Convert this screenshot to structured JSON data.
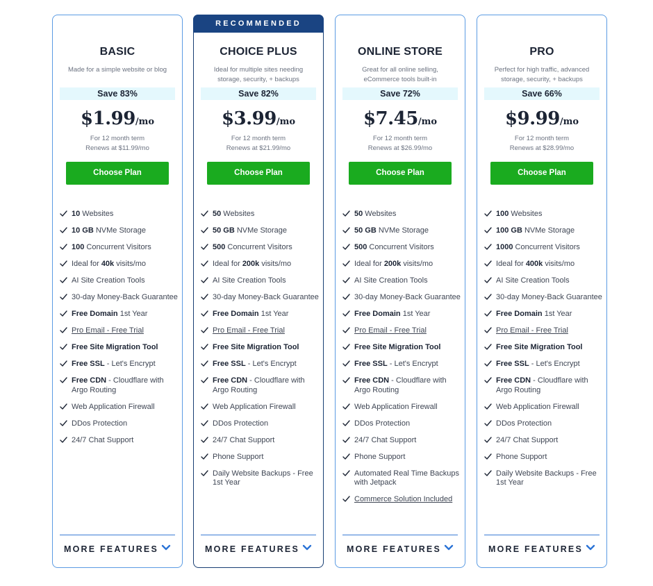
{
  "colors": {
    "card_border": "#5b9be3",
    "recommended_border": "#173d72",
    "recommended_banner": "#1a4482",
    "save_bg": "#e4f8fd",
    "button": "#1aab1f",
    "divider": "#3a7bd5",
    "chevron": "#2b73d6"
  },
  "recommended_label": "RECOMMENDED",
  "plans": [
    {
      "name": "BASIC",
      "description": "Made for a simple website or blog",
      "save": "Save 83%",
      "price": "$1.99",
      "per": "/mo",
      "term": "For 12 month term",
      "renews": "Renews at $11.99/mo",
      "button": "Choose Plan",
      "more": "MORE FEATURES",
      "features": [
        {
          "bold": "10",
          "text": " Websites"
        },
        {
          "bold": "10 GB",
          "text": " NVMe Storage"
        },
        {
          "bold": "100",
          "text": " Concurrent Visitors"
        },
        {
          "pre": "Ideal for ",
          "bold": "40k",
          "text": " visits/mo"
        },
        {
          "text": "AI Site Creation Tools"
        },
        {
          "text": "30-day Money-Back Guarantee"
        },
        {
          "bold": "Free Domain",
          "text": " 1st Year"
        },
        {
          "link": "Pro Email - Free Trial"
        },
        {
          "bold": "Free Site Migration Tool"
        },
        {
          "bold": "Free SSL",
          "text": " - Let's Encrypt"
        },
        {
          "bold": "Free CDN",
          "text": " - Cloudflare with Argo Routing"
        },
        {
          "text": "Web Application Firewall"
        },
        {
          "text": "DDos Protection"
        },
        {
          "text": "24/7 Chat Support"
        }
      ]
    },
    {
      "name": "CHOICE PLUS",
      "recommended": true,
      "description": "Ideal for multiple sites needing storage, security, + backups",
      "save": "Save 82%",
      "price": "$3.99",
      "per": "/mo",
      "term": "For 12 month term",
      "renews": "Renews at $21.99/mo",
      "button": "Choose Plan",
      "more": "MORE FEATURES",
      "features": [
        {
          "bold": "50",
          "text": " Websites"
        },
        {
          "bold": "50 GB",
          "text": " NVMe Storage"
        },
        {
          "bold": "500",
          "text": " Concurrent Visitors"
        },
        {
          "pre": "Ideal for ",
          "bold": "200k",
          "text": " visits/mo"
        },
        {
          "text": "AI Site Creation Tools"
        },
        {
          "text": "30-day Money-Back Guarantee"
        },
        {
          "bold": "Free Domain",
          "text": " 1st Year"
        },
        {
          "link": "Pro Email - Free Trial"
        },
        {
          "bold": "Free Site Migration Tool"
        },
        {
          "bold": "Free SSL",
          "text": " - Let's Encrypt"
        },
        {
          "bold": "Free CDN",
          "text": " - Cloudflare with Argo Routing"
        },
        {
          "text": "Web Application Firewall"
        },
        {
          "text": "DDos Protection"
        },
        {
          "text": "24/7 Chat Support"
        },
        {
          "text": "Phone Support"
        },
        {
          "text": "Daily Website Backups - Free 1st Year"
        }
      ]
    },
    {
      "name": "ONLINE STORE",
      "description": "Great for all online selling, eCommerce tools built-in",
      "save": "Save 72%",
      "price": "$7.45",
      "per": "/mo",
      "term": "For 12 month term",
      "renews": "Renews at $26.99/mo",
      "button": "Choose Plan",
      "more": "MORE FEATURES",
      "features": [
        {
          "bold": "50",
          "text": " Websites"
        },
        {
          "bold": "50 GB",
          "text": " NVMe Storage"
        },
        {
          "bold": "500",
          "text": " Concurrent Visitors"
        },
        {
          "pre": "Ideal for ",
          "bold": "200k",
          "text": " visits/mo"
        },
        {
          "text": "AI Site Creation Tools"
        },
        {
          "text": "30-day Money-Back Guarantee"
        },
        {
          "bold": "Free Domain",
          "text": " 1st Year"
        },
        {
          "link": "Pro Email - Free Trial"
        },
        {
          "bold": "Free Site Migration Tool"
        },
        {
          "bold": "Free SSL",
          "text": " - Let's Encrypt"
        },
        {
          "bold": "Free CDN",
          "text": " - Cloudflare with Argo Routing"
        },
        {
          "text": "Web Application Firewall"
        },
        {
          "text": "DDos Protection"
        },
        {
          "text": "24/7 Chat Support"
        },
        {
          "text": "Phone Support"
        },
        {
          "text": "Automated Real Time Backups with Jetpack"
        },
        {
          "link": "Commerce Solution Included"
        }
      ]
    },
    {
      "name": "PRO",
      "description": "Perfect for high traffic, advanced storage, security, + backups",
      "save": "Save 66%",
      "price": "$9.99",
      "per": "/mo",
      "term": "For 12 month term",
      "renews": "Renews at $28.99/mo",
      "button": "Choose Plan",
      "more": "MORE FEATURES",
      "features": [
        {
          "bold": "100",
          "text": " Websites"
        },
        {
          "bold": "100 GB",
          "text": " NVMe Storage"
        },
        {
          "bold": "1000",
          "text": " Concurrent Visitors"
        },
        {
          "pre": "Ideal for ",
          "bold": "400k",
          "text": " visits/mo"
        },
        {
          "text": "AI Site Creation Tools"
        },
        {
          "text": "30-day Money-Back Guarantee"
        },
        {
          "bold": "Free Domain",
          "text": " 1st Year"
        },
        {
          "link": "Pro Email - Free Trial"
        },
        {
          "bold": "Free Site Migration Tool"
        },
        {
          "bold": "Free SSL",
          "text": " - Let's Encrypt"
        },
        {
          "bold": "Free CDN",
          "text": " - Cloudflare with Argo Routing"
        },
        {
          "text": "Web Application Firewall"
        },
        {
          "text": "DDos Protection"
        },
        {
          "text": "24/7 Chat Support"
        },
        {
          "text": "Phone Support"
        },
        {
          "text": "Daily Website Backups - Free 1st Year"
        }
      ]
    }
  ]
}
